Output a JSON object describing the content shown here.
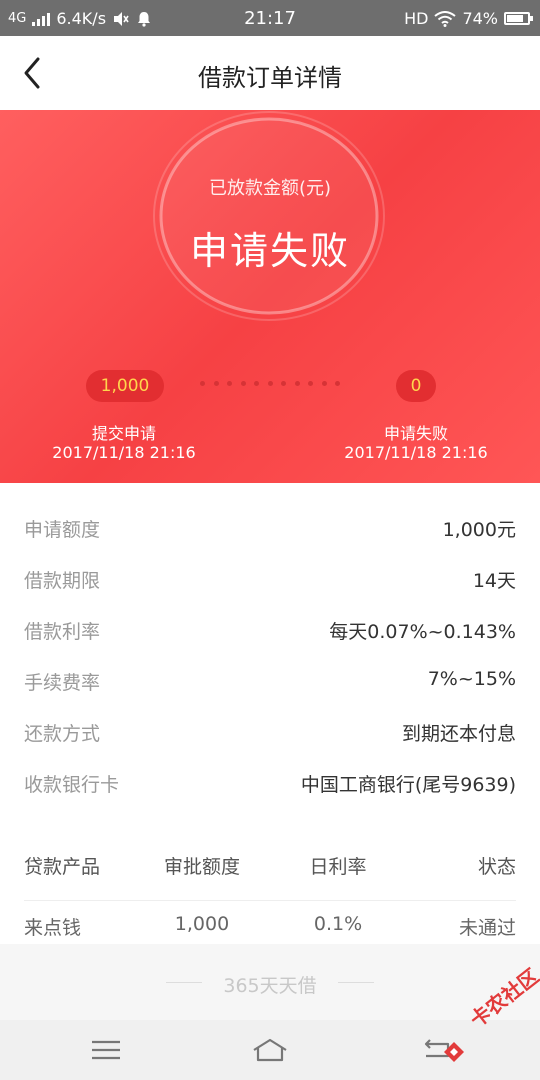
{
  "status_bar": {
    "network": "4G",
    "speed": "6.4K/s",
    "time": "21:17",
    "hd": "HD",
    "battery": "74%"
  },
  "header": {
    "title": "借款订单详情"
  },
  "hero": {
    "amount_label": "已放款金额(元)",
    "status": "申请失败",
    "left_pill": "1,000",
    "right_pill": "0",
    "left_step_title": "提交申请",
    "left_step_date": "2017/11/18 21:16",
    "right_step_title": "申请失败",
    "right_step_date": "2017/11/18 21:16"
  },
  "details": [
    {
      "label": "申请额度",
      "value": "1,000元"
    },
    {
      "label": "借款期限",
      "value": "14天"
    },
    {
      "label": "借款利率",
      "value": "每天0.07%~0.143%"
    },
    {
      "label": "手续费率",
      "value": "7%~15%"
    },
    {
      "label": "还款方式",
      "value": "到期还本付息"
    },
    {
      "label": "收款银行卡",
      "value": "中国工商银行(尾号9639)"
    }
  ],
  "table": {
    "headers": [
      "贷款产品",
      "审批额度",
      "日利率",
      "状态"
    ],
    "rows": [
      [
        "来点钱",
        "1,000",
        "0.1%",
        "未通过"
      ]
    ]
  },
  "footer_ad": {
    "text": "365天天借"
  },
  "watermark": {
    "text": "卡农社区"
  },
  "colors": {
    "hero_red": "#f64144",
    "pill_red": "#e22e31",
    "pill_text": "#ffd54d",
    "watermark": "#e23b3b"
  },
  "icons": {
    "back": "chevron-left-icon",
    "notification": "bell-icon",
    "mute": "speaker-mute-icon",
    "wifi": "wifi-icon",
    "battery": "battery-icon",
    "nav_menu": "menu-icon",
    "nav_home": "home-icon",
    "nav_back": "back-arrow-icon"
  }
}
